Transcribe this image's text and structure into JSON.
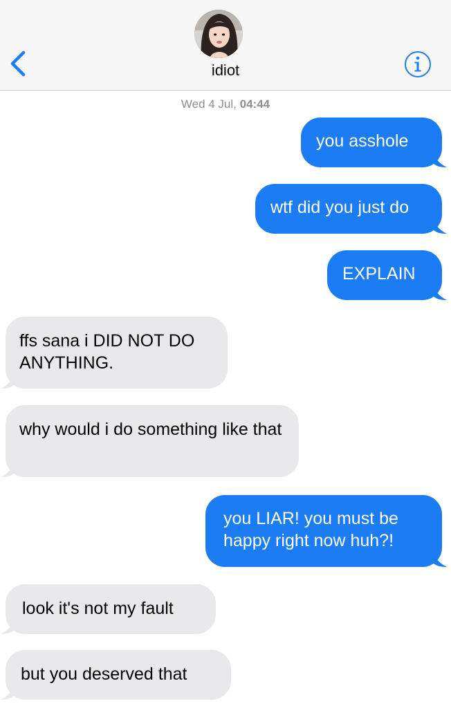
{
  "header": {
    "contact_name": "idiot",
    "back_icon": "chevron-left-icon",
    "info_icon": "info-icon",
    "accent_color": "#1b7cf4"
  },
  "conversation": {
    "date_label": "Wed 4 Jul,",
    "time_label": "04:44",
    "messages": [
      {
        "direction": "sent",
        "text": "you asshole"
      },
      {
        "direction": "sent",
        "text": "wtf did you just do"
      },
      {
        "direction": "sent",
        "text": "EXPLAIN"
      },
      {
        "direction": "received",
        "text": "ffs sana i DID NOT DO ANYTHING."
      },
      {
        "direction": "received",
        "text": "why would i do something like that"
      },
      {
        "direction": "sent",
        "text": "you LIAR! you must be happy right now huh?!"
      },
      {
        "direction": "received",
        "text": "look it's not my fault"
      },
      {
        "direction": "received",
        "text": "but you deserved that"
      }
    ]
  },
  "colors": {
    "sent_bubble": "#1b7cf4",
    "received_bubble": "#e9e9eb",
    "header_bg": "#f7f7f7",
    "timestamp": "#8e8e93"
  }
}
